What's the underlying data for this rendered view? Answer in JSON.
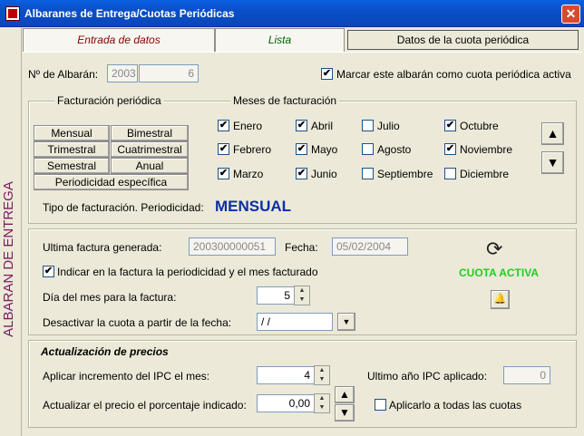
{
  "window": {
    "title": "Albaranes de Entrega/Cuotas Periódicas",
    "close_label": "✕"
  },
  "sidebar": {
    "label": "ALBARAN DE ENTREGA"
  },
  "tabs": {
    "entrada": "Entrada de datos",
    "lista": "Lista",
    "cuota": "Datos de la cuota periódica"
  },
  "albaran": {
    "label": "Nº de Albarán:",
    "serie": "2003",
    "numero": "6"
  },
  "marcar": {
    "label": "Marcar este albarán como cuota periódica activa",
    "checked": "✔"
  },
  "facturacion": {
    "legend": "Facturación periódica",
    "buttons": {
      "mensual": "Mensual",
      "bimestral": "Bimestral",
      "trimestral": "Trimestral",
      "cuatrimestral": "Cuatrimestral",
      "semestral": "Semestral",
      "anual": "Anual",
      "especifica": "Periodicidad específica"
    }
  },
  "meses": {
    "legend": "Meses de facturación",
    "enero": {
      "label": "Enero",
      "mark": "✔"
    },
    "febrero": {
      "label": "Febrero",
      "mark": "✔"
    },
    "marzo": {
      "label": "Marzo",
      "mark": "✔"
    },
    "abril": {
      "label": "Abril",
      "mark": "✔"
    },
    "mayo": {
      "label": "Mayo",
      "mark": "✔"
    },
    "junio": {
      "label": "Junio",
      "mark": "✔"
    },
    "julio": {
      "label": "Julio",
      "mark": ""
    },
    "agosto": {
      "label": "Agosto",
      "mark": ""
    },
    "septiembre": {
      "label": "Septiembre",
      "mark": ""
    },
    "octubre": {
      "label": "Octubre",
      "mark": "✔"
    },
    "noviembre": {
      "label": "Noviembre",
      "mark": "✔"
    },
    "diciembre": {
      "label": "Diciembre",
      "mark": ""
    },
    "up_icon": "▲",
    "down_icon": "▼"
  },
  "tipo": {
    "label": "Tipo de facturación. Periodicidad:",
    "value": "MENSUAL"
  },
  "ultima": {
    "label": "Ultima factura generada:",
    "value": "200300000051",
    "fecha_label": "Fecha:",
    "fecha": "05/02/2004"
  },
  "estado": {
    "refresh_icon": "⟳",
    "text": "CUOTA ACTIVA",
    "bell_icon": "🔔"
  },
  "indicar": {
    "label": "Indicar en la factura la periodicidad y el mes facturado",
    "mark": "✔"
  },
  "dia": {
    "label": "Día del mes para la factura:",
    "value": "5"
  },
  "desactivar": {
    "label": "Desactivar la cuota a partir de la fecha:",
    "value": "/ /",
    "button_icon": "▼"
  },
  "precios": {
    "legend": "Actualización de precios",
    "ipc_label": "Aplicar incremento del IPC el mes:",
    "ipc_value": "4",
    "ultimo_ipc_label": "Ultimo año IPC aplicado:",
    "ultimo_ipc_value": "0",
    "porcentaje_label": "Actualizar el precio el porcentaje indicado:",
    "porcentaje_value": "0,00",
    "aplicar_label": "Aplicarlo a todas las cuotas",
    "aplicar_mark": ""
  }
}
